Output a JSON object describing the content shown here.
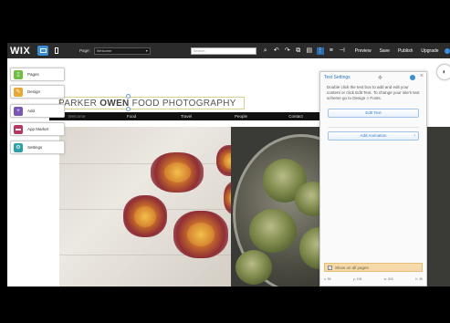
{
  "editor": {
    "logo": "WIX",
    "page_label": "Page:",
    "page_value": "Welcome",
    "search_placeholder": "Search",
    "actions": [
      "Preview",
      "Save",
      "Publish",
      "Upgrade"
    ]
  },
  "left_panel": [
    {
      "label": "Pages",
      "icon": "pages-icon",
      "color": "#6fbd43"
    },
    {
      "label": "Design",
      "icon": "design-icon",
      "color": "#e7a934"
    },
    {
      "label": "Add",
      "icon": "add-icon",
      "color": "#7a57b7"
    },
    {
      "label": "App Market",
      "icon": "app-market-icon",
      "color": "#b33963"
    },
    {
      "label": "Settings",
      "icon": "settings-icon",
      "color": "#2aa2a5"
    }
  ],
  "site": {
    "title_pre": "PARKER ",
    "title_bold": "OWEN",
    "title_post": " FOOD PHOTOGRAPHY",
    "nav": [
      "Welcome",
      "Food",
      "Travel",
      "People",
      "Contact"
    ]
  },
  "text_settings": {
    "title": "Text Settings",
    "description": "Double click the text box to add and edit your content or click Edit Text. To change your site's text scheme go to Design > Fonts.",
    "edit_button": "Edit Text",
    "animation_label": "Add Animation",
    "show_all_pages": "Show on all pages",
    "coords": [
      "x: 55",
      "y: 108",
      "w: 500",
      "h: 35"
    ]
  },
  "colors": {
    "toolbar_bg": "#2b2b2b",
    "accent": "#3a8fd8"
  }
}
